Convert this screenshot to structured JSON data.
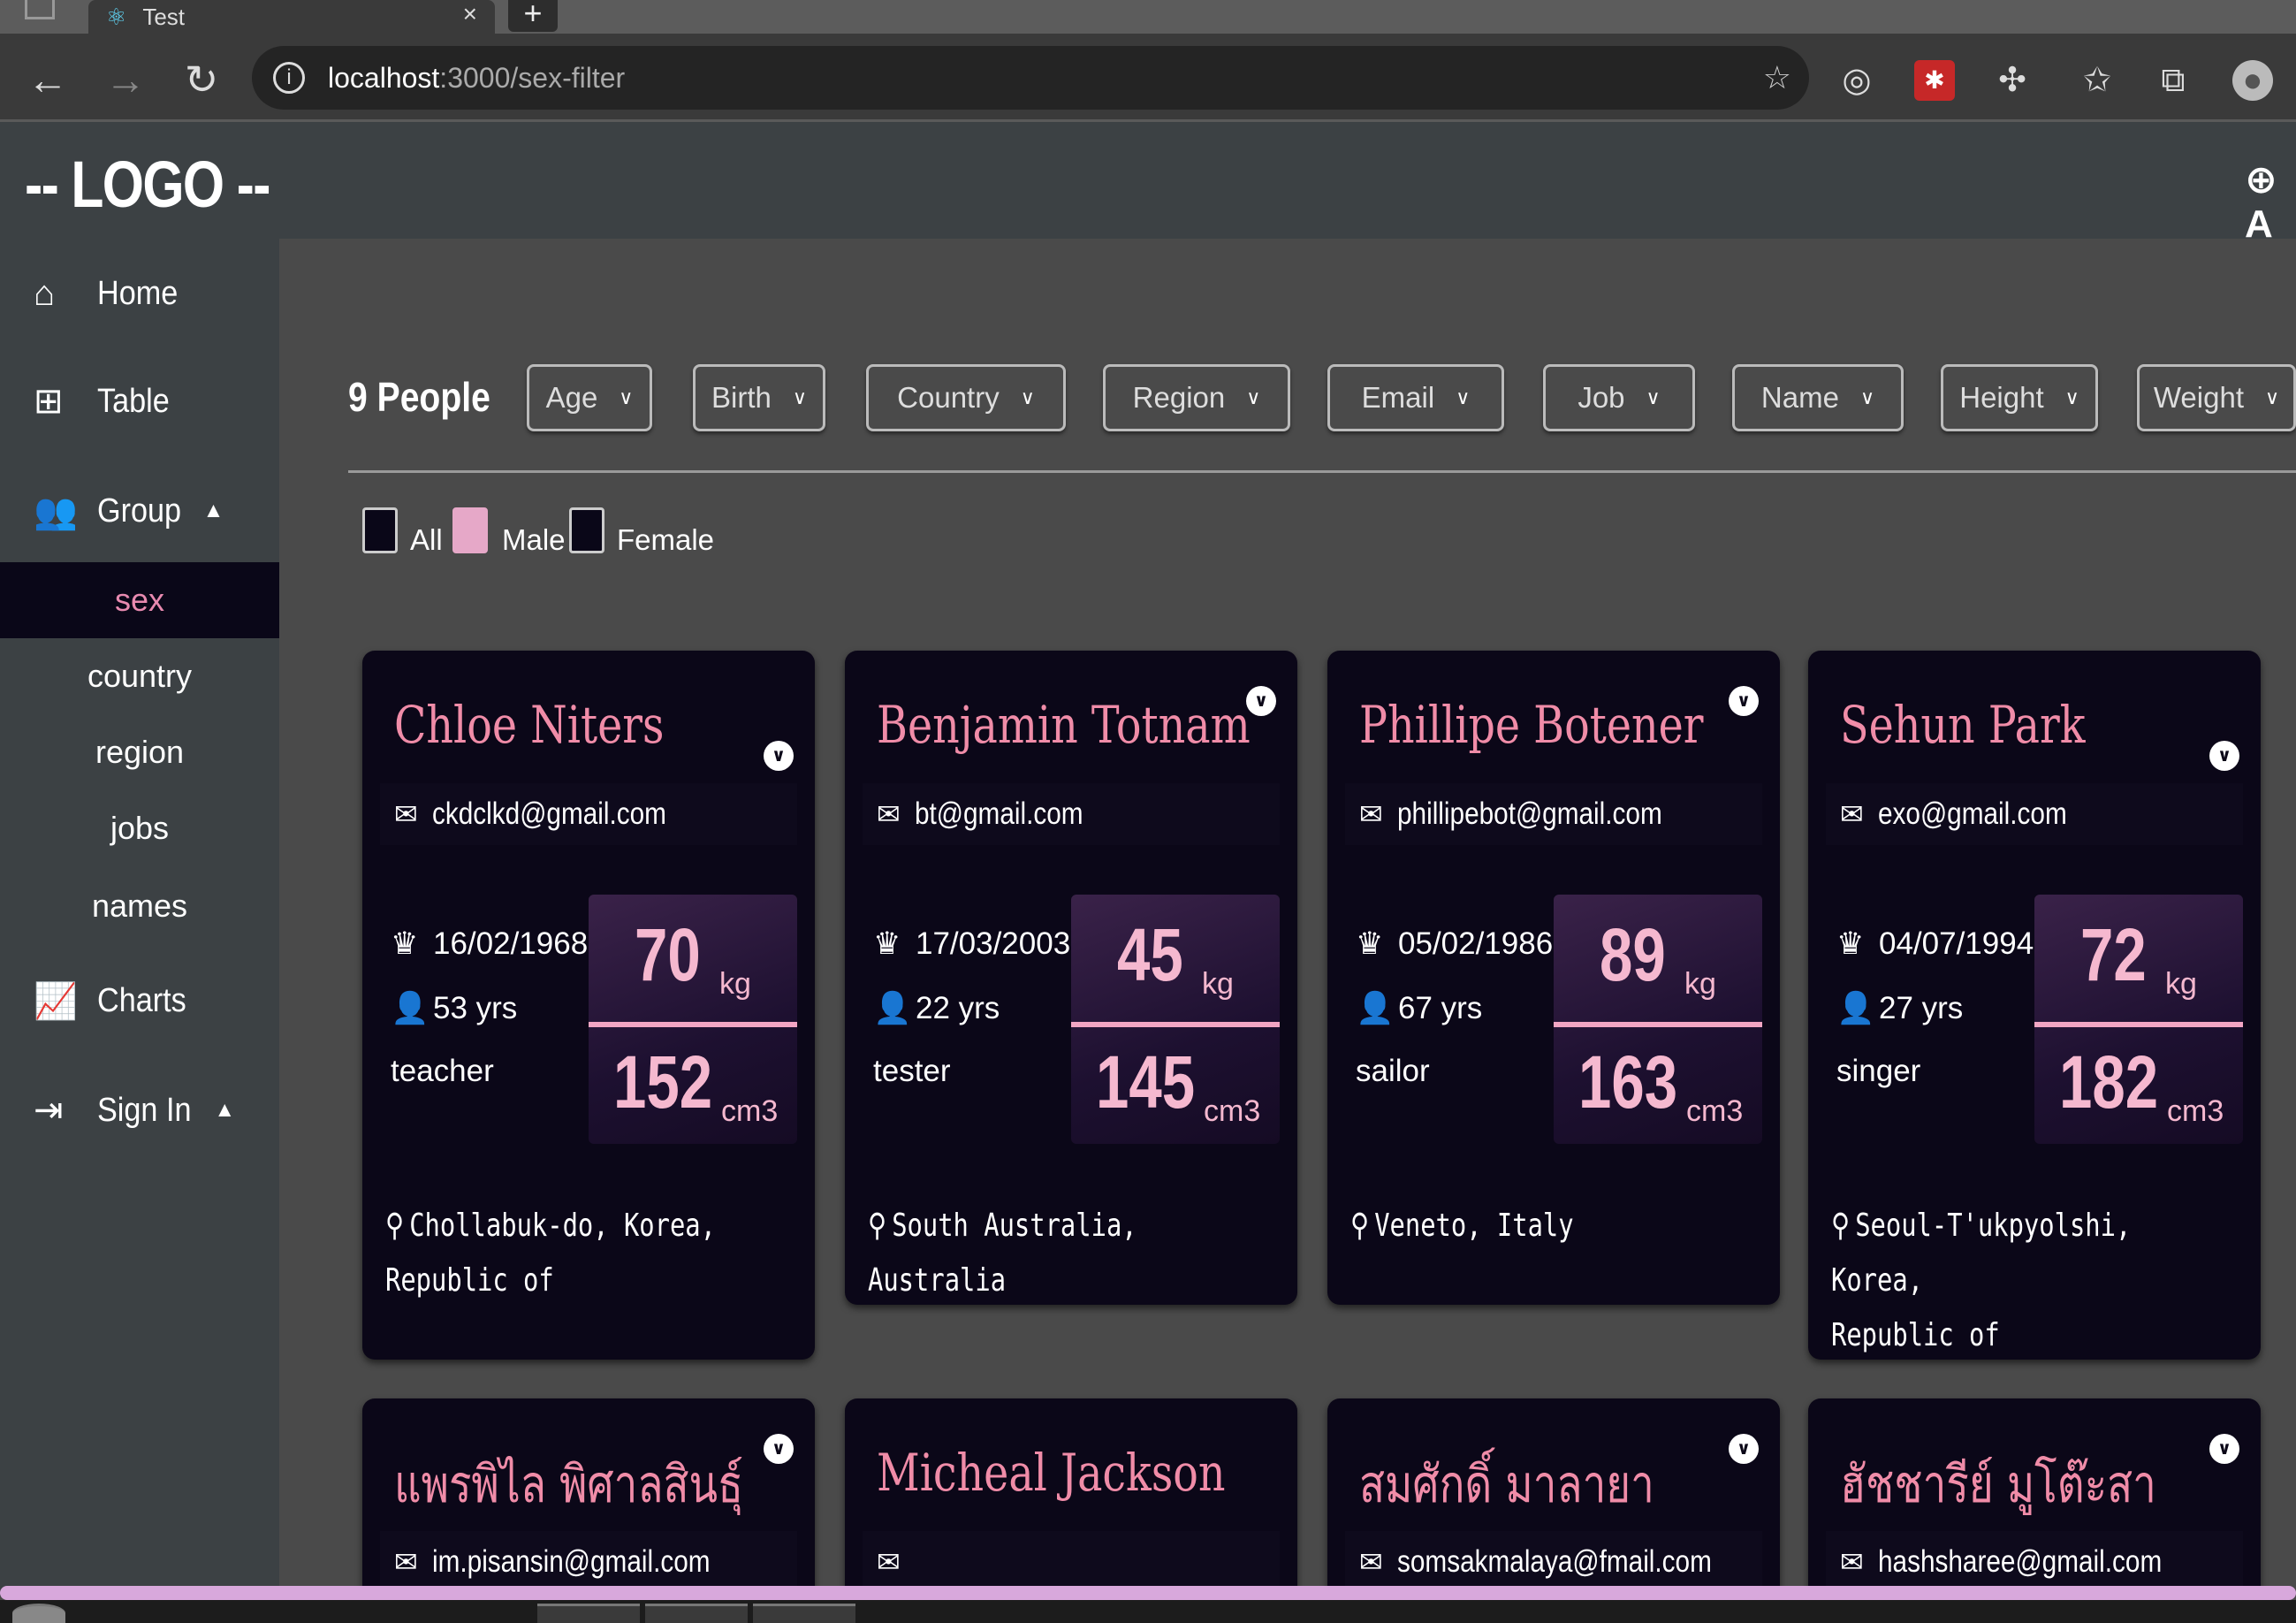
{
  "browser": {
    "tab_title": "Test",
    "url_host": "localhost",
    "url_path": ":3000/sex-filter",
    "new_tab_glyph": "+",
    "close_glyph": "×"
  },
  "header": {
    "logo": "-- LOGO --",
    "add_label": "⊕ A"
  },
  "sidebar": {
    "home": "Home",
    "table": "Table",
    "group": "Group",
    "sub": [
      "sex",
      "country",
      "region",
      "jobs",
      "names"
    ],
    "charts": "Charts",
    "signin": "Sign In"
  },
  "main": {
    "count": "9 People",
    "filters": [
      "Age",
      "Birth",
      "Country",
      "Region",
      "Email",
      "Job",
      "Name",
      "Height",
      "Weight"
    ],
    "checkboxes": [
      "All",
      "Male",
      "Female"
    ]
  },
  "cards": [
    {
      "name": "Chloe Niters",
      "email": "ckdclkd@gmail.com",
      "birth": "16/02/1968",
      "age": "53 yrs",
      "job": "teacher",
      "weight": "70",
      "height": "152",
      "loc1": "Chollabuk-do, Korea,",
      "loc2": "Republic of"
    },
    {
      "name": "Benjamin Totnam",
      "email": "bt@gmail.com",
      "birth": "17/03/2003",
      "age": "22 yrs",
      "job": "tester",
      "weight": "45",
      "height": "145",
      "loc1": "South Australia, Australia",
      "loc2": ""
    },
    {
      "name": "Phillipe Botener",
      "email": "phillipebot@gmail.com",
      "birth": "05/02/1986",
      "age": "67 yrs",
      "job": "sailor",
      "weight": "89",
      "height": "163",
      "loc1": "Veneto, Italy",
      "loc2": ""
    },
    {
      "name": "Sehun Park",
      "email": "exo@gmail.com",
      "birth": "04/07/1994",
      "age": "27 yrs",
      "job": "singer",
      "weight": "72",
      "height": "182",
      "loc1": "Seoul-T'ukpyolshi, Korea,",
      "loc2": "Republic of"
    },
    {
      "name": "แพรพิไล พิศาลสินธุ์",
      "email": "im.pisansin@gmail.com"
    },
    {
      "name": "Micheal Jackson",
      "email": ""
    },
    {
      "name": "สมศักดิ์ มาลายา",
      "email": "somsakmalaya@fmail.com"
    },
    {
      "name": "ฮัชชารีย์ มูโต๊ะสา",
      "email": "hashsharee@gmail.com"
    }
  ],
  "units": {
    "weight": "kg",
    "height": "cm3"
  }
}
